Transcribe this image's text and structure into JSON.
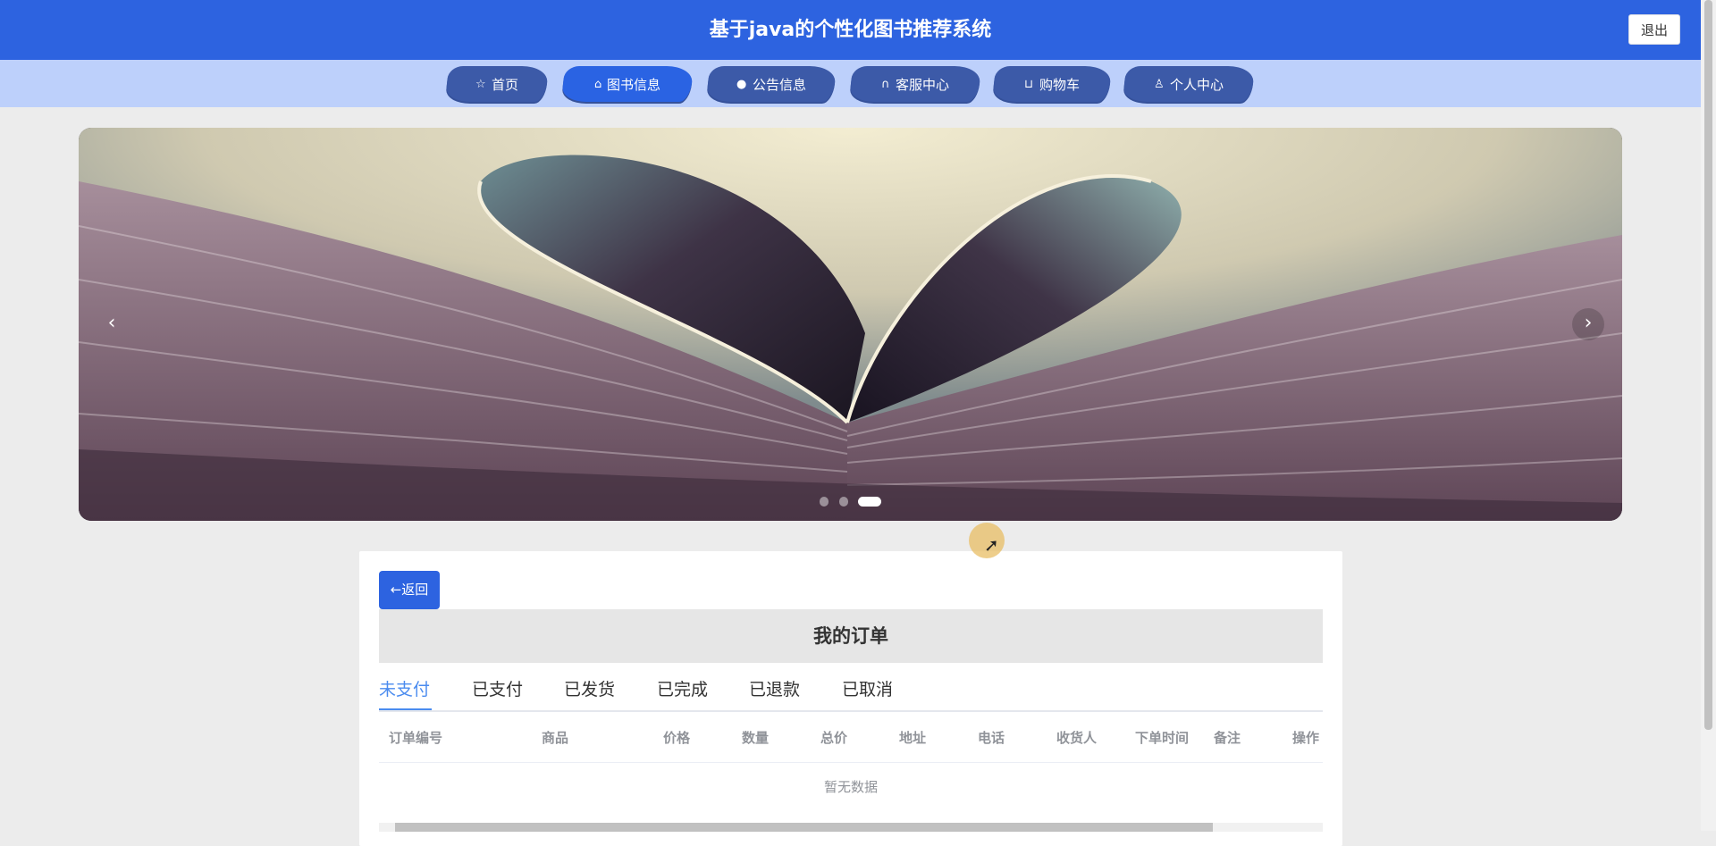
{
  "header": {
    "title": "基于java的个性化图书推荐系统",
    "user": "",
    "logout_label": "退出",
    "accent_color": "#2d63e0"
  },
  "nav": {
    "items": [
      {
        "label": "首页",
        "icon": "star-icon",
        "active": false
      },
      {
        "label": "图书信息",
        "icon": "bag-icon",
        "active": true
      },
      {
        "label": "公告信息",
        "icon": "info-icon",
        "active": false
      },
      {
        "label": "客服中心",
        "icon": "headset-icon",
        "active": false
      },
      {
        "label": "购物车",
        "icon": "cart-icon",
        "active": false
      },
      {
        "label": "个人中心",
        "icon": "user-icon",
        "active": false
      }
    ]
  },
  "carousel": {
    "slide_count": 3,
    "active_index": 2,
    "image": "open-book-heart-pages"
  },
  "orders": {
    "back_label": "←返回",
    "title": "我的订单",
    "tabs": [
      "未支付",
      "已支付",
      "已发货",
      "已完成",
      "已退款",
      "已取消"
    ],
    "active_tab": 0,
    "columns": [
      "订单编号",
      "商品",
      "价格",
      "数量",
      "总价",
      "地址",
      "电话",
      "收货人",
      "下单时间",
      "备注",
      "操作"
    ],
    "empty_text": "暂无数据"
  }
}
